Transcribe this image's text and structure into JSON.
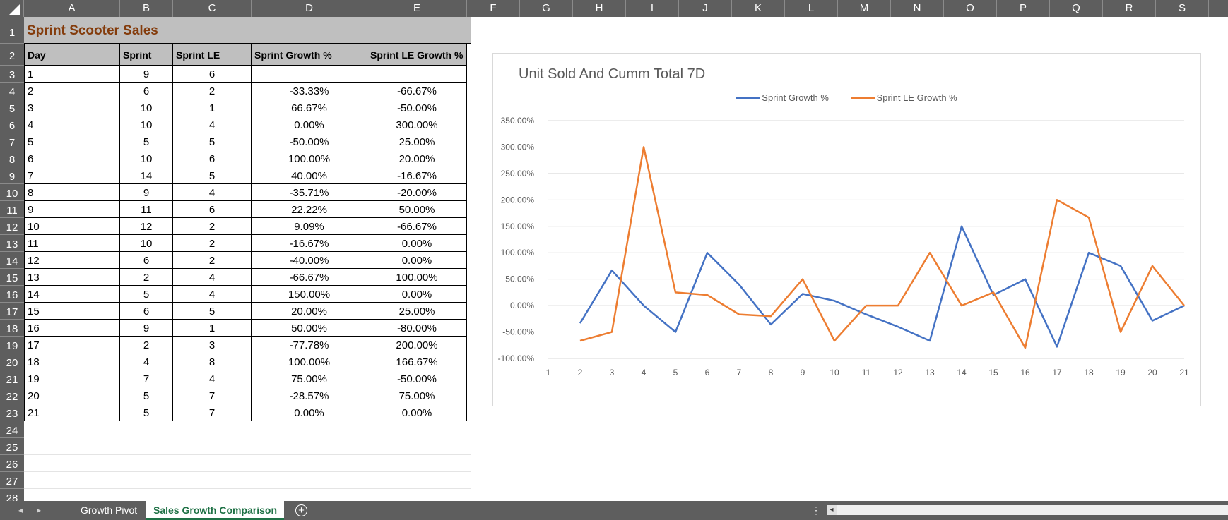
{
  "columns": [
    "A",
    "B",
    "C",
    "D",
    "E",
    "F",
    "G",
    "H",
    "I",
    "J",
    "K",
    "L",
    "M",
    "N",
    "O",
    "P",
    "Q",
    "R",
    "S"
  ],
  "rows": [
    "1",
    "2",
    "3",
    "4",
    "5",
    "6",
    "7",
    "8",
    "9",
    "10",
    "11",
    "12",
    "13",
    "14",
    "15",
    "16",
    "17",
    "18",
    "19",
    "20",
    "21",
    "22",
    "23",
    "24",
    "25",
    "26",
    "27",
    "28"
  ],
  "sheet": {
    "title": "Sprint Scooter Sales",
    "headers": [
      "Day",
      "Sprint",
      "Sprint LE",
      "Sprint Growth %",
      "Sprint LE Growth %"
    ],
    "data": [
      [
        "1",
        "9",
        "6",
        "",
        ""
      ],
      [
        "2",
        "6",
        "2",
        "-33.33%",
        "-66.67%"
      ],
      [
        "3",
        "10",
        "1",
        "66.67%",
        "-50.00%"
      ],
      [
        "4",
        "10",
        "4",
        "0.00%",
        "300.00%"
      ],
      [
        "5",
        "5",
        "5",
        "-50.00%",
        "25.00%"
      ],
      [
        "6",
        "10",
        "6",
        "100.00%",
        "20.00%"
      ],
      [
        "7",
        "14",
        "5",
        "40.00%",
        "-16.67%"
      ],
      [
        "8",
        "9",
        "4",
        "-35.71%",
        "-20.00%"
      ],
      [
        "9",
        "11",
        "6",
        "22.22%",
        "50.00%"
      ],
      [
        "10",
        "12",
        "2",
        "9.09%",
        "-66.67%"
      ],
      [
        "11",
        "10",
        "2",
        "-16.67%",
        "0.00%"
      ],
      [
        "12",
        "6",
        "2",
        "-40.00%",
        "0.00%"
      ],
      [
        "13",
        "2",
        "4",
        "-66.67%",
        "100.00%"
      ],
      [
        "14",
        "5",
        "4",
        "150.00%",
        "0.00%"
      ],
      [
        "15",
        "6",
        "5",
        "20.00%",
        "25.00%"
      ],
      [
        "16",
        "9",
        "1",
        "50.00%",
        "-80.00%"
      ],
      [
        "17",
        "2",
        "3",
        "-77.78%",
        "200.00%"
      ],
      [
        "18",
        "4",
        "8",
        "100.00%",
        "166.67%"
      ],
      [
        "19",
        "7",
        "4",
        "75.00%",
        "-50.00%"
      ],
      [
        "20",
        "5",
        "7",
        "-28.57%",
        "75.00%"
      ],
      [
        "21",
        "5",
        "7",
        "0.00%",
        "0.00%"
      ]
    ]
  },
  "chart_data": {
    "type": "line",
    "title": "Unit Sold And Cumm Total 7D",
    "x": [
      1,
      2,
      3,
      4,
      5,
      6,
      7,
      8,
      9,
      10,
      11,
      12,
      13,
      14,
      15,
      16,
      17,
      18,
      19,
      20,
      21
    ],
    "series": [
      {
        "name": "Sprint Growth %",
        "color": "#4472c4",
        "values": [
          null,
          -33.33,
          66.67,
          0,
          -50,
          100,
          40,
          -35.71,
          22.22,
          9.09,
          -16.67,
          -40,
          -66.67,
          150,
          20,
          50,
          -77.78,
          100,
          75,
          -28.57,
          0
        ]
      },
      {
        "name": "Sprint LE Growth %",
        "color": "#ed7d31",
        "values": [
          null,
          -66.67,
          -50,
          300,
          25,
          20,
          -16.67,
          -20,
          50,
          -66.67,
          0,
          0,
          100,
          0,
          25,
          -80,
          200,
          166.67,
          -50,
          75,
          0
        ]
      }
    ],
    "ylim": [
      -100,
      350
    ],
    "yticks": [
      "350.00%",
      "300.00%",
      "250.00%",
      "200.00%",
      "150.00%",
      "100.00%",
      "50.00%",
      "0.00%",
      "-50.00%",
      "-100.00%"
    ],
    "xticks": [
      "1",
      "2",
      "3",
      "4",
      "5",
      "6",
      "7",
      "8",
      "9",
      "10",
      "11",
      "12",
      "13",
      "14",
      "15",
      "16",
      "17",
      "18",
      "19",
      "20",
      "21"
    ],
    "grid": true,
    "legend": "top"
  },
  "tabs": [
    "Growth Pivot",
    "Sales Growth Comparison"
  ],
  "active_tab": "Sales Growth Comparison",
  "add_sheet_label": "+",
  "nav": {
    "prev": "◂",
    "next": "▸"
  },
  "more": "⋮",
  "scroll_left": "◂"
}
